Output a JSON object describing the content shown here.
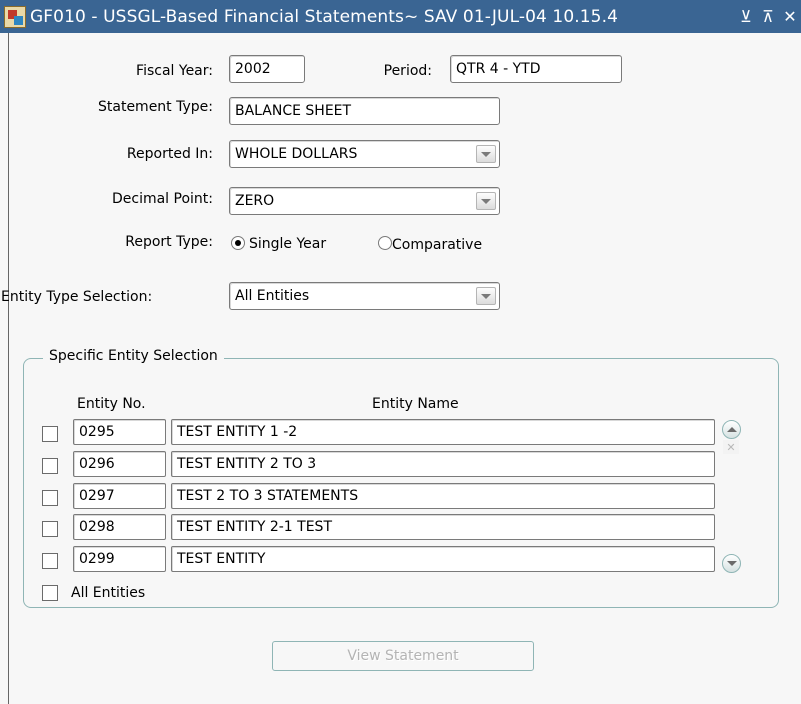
{
  "window": {
    "title": "GF010 - USSGL-Based Financial Statements~ SAV 01-JUL-04 10.15.4",
    "controls": {
      "minimize": "⊻",
      "maximize": "⊼",
      "close": "✕"
    }
  },
  "form": {
    "fiscal_year": {
      "label": "Fiscal Year:",
      "value": "2002"
    },
    "period": {
      "label": "Period:",
      "value": "QTR 4 - YTD"
    },
    "statement_type": {
      "label": "Statement Type:",
      "value": "BALANCE SHEET"
    },
    "reported_in": {
      "label": "Reported In:",
      "value": "WHOLE DOLLARS"
    },
    "decimal_point": {
      "label": "Decimal Point:",
      "value": "ZERO"
    },
    "report_type": {
      "label": "Report Type:",
      "options": [
        "Single Year",
        "Comparative"
      ],
      "selected": "Single Year"
    },
    "entity_type_selection": {
      "label": "Entity Type Selection:",
      "value": "All Entities"
    }
  },
  "entity_group": {
    "title": "Specific Entity Selection",
    "columns": {
      "entity_no": "Entity No.",
      "entity_name": "Entity Name"
    },
    "rows": [
      {
        "no": "0295",
        "name": "TEST ENTITY 1 -2",
        "checked": false
      },
      {
        "no": "0296",
        "name": "TEST ENTITY 2 TO 3",
        "checked": false
      },
      {
        "no": "0297",
        "name": "TEST 2 TO 3 STATEMENTS",
        "checked": false
      },
      {
        "no": "0298",
        "name": "TEST ENTITY 2-1 TEST",
        "checked": false
      },
      {
        "no": "0299",
        "name": "TEST ENTITY",
        "checked": false
      }
    ],
    "all_entities_label": "All Entities"
  },
  "actions": {
    "view_statement": "View Statement"
  },
  "colors": {
    "titlebar": "#3a6593",
    "client_bg": "#f7f7f7",
    "group_border": "#8fb5b5",
    "disabled_text": "#b4b4b4"
  }
}
